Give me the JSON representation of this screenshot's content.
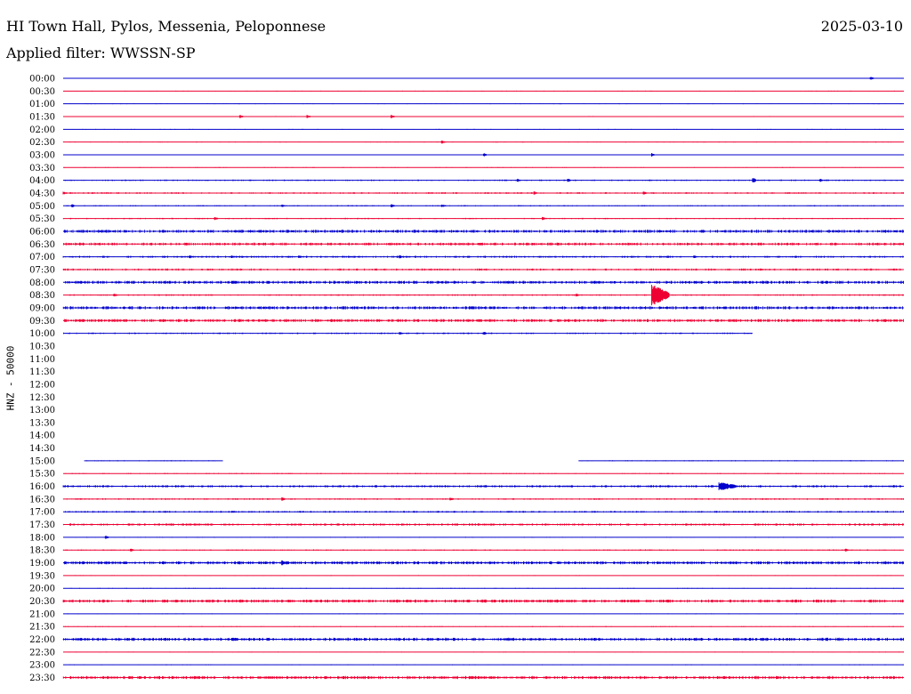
{
  "header": {
    "station": "HI Town Hall, Pylos, Messenia, Peloponnese",
    "date": "2025-03-10",
    "filter": "Applied filter: WWSSN-SP"
  },
  "chart_data": {
    "type": "line",
    "ylabel": "HNZ - 50000",
    "colors": {
      "even_row": "#0000cc",
      "odd_row": "#ee0033"
    },
    "rows": [
      {
        "time": "00:00",
        "coverage": [
          [
            0,
            1
          ]
        ],
        "activity": 0.05,
        "events": [
          {
            "pos": 0.96,
            "amp": 2
          }
        ]
      },
      {
        "time": "00:30",
        "coverage": [
          [
            0,
            1
          ]
        ],
        "activity": 0.05,
        "events": []
      },
      {
        "time": "01:00",
        "coverage": [
          [
            0,
            1
          ]
        ],
        "activity": 0.05,
        "events": []
      },
      {
        "time": "01:30",
        "coverage": [
          [
            0,
            1
          ]
        ],
        "activity": 0.12,
        "events": [
          {
            "pos": 0.21,
            "amp": 2
          },
          {
            "pos": 0.29,
            "amp": 2
          },
          {
            "pos": 0.39,
            "amp": 2
          }
        ]
      },
      {
        "time": "02:00",
        "coverage": [
          [
            0,
            1
          ]
        ],
        "activity": 0.05,
        "events": []
      },
      {
        "time": "02:30",
        "coverage": [
          [
            0,
            1
          ]
        ],
        "activity": 0.08,
        "events": [
          {
            "pos": 0.45,
            "amp": 2
          }
        ]
      },
      {
        "time": "03:00",
        "coverage": [
          [
            0,
            1
          ]
        ],
        "activity": 0.08,
        "events": [
          {
            "pos": 0.5,
            "amp": 2
          },
          {
            "pos": 0.7,
            "amp": 2
          }
        ]
      },
      {
        "time": "03:30",
        "coverage": [
          [
            0,
            1
          ]
        ],
        "activity": 0.05,
        "events": []
      },
      {
        "time": "04:00",
        "coverage": [
          [
            0,
            1
          ]
        ],
        "activity": 0.35,
        "events": [
          {
            "pos": 0.54,
            "amp": 2
          },
          {
            "pos": 0.6,
            "amp": 2
          },
          {
            "pos": 0.82,
            "amp": 4
          },
          {
            "pos": 0.9,
            "amp": 2
          }
        ]
      },
      {
        "time": "04:30",
        "coverage": [
          [
            0,
            1
          ]
        ],
        "activity": 0.45,
        "events": [
          {
            "pos": 0.0,
            "amp": 2
          },
          {
            "pos": 0.56,
            "amp": 2
          },
          {
            "pos": 0.69,
            "amp": 2
          }
        ]
      },
      {
        "time": "05:00",
        "coverage": [
          [
            0,
            1
          ]
        ],
        "activity": 0.25,
        "events": [
          {
            "pos": 0.01,
            "amp": 2
          },
          {
            "pos": 0.26,
            "amp": 2
          },
          {
            "pos": 0.39,
            "amp": 2
          },
          {
            "pos": 0.45,
            "amp": 2
          }
        ]
      },
      {
        "time": "05:30",
        "coverage": [
          [
            0,
            1
          ]
        ],
        "activity": 0.3,
        "events": [
          {
            "pos": 0.18,
            "amp": 2
          },
          {
            "pos": 0.57,
            "amp": 2
          }
        ]
      },
      {
        "time": "06:00",
        "coverage": [
          [
            0,
            1
          ]
        ],
        "activity": 1.0,
        "events": []
      },
      {
        "time": "06:30",
        "coverage": [
          [
            0,
            1
          ]
        ],
        "activity": 0.9,
        "events": []
      },
      {
        "time": "07:00",
        "coverage": [
          [
            0,
            1
          ]
        ],
        "activity": 0.6,
        "events": [
          {
            "pos": 0.15,
            "amp": 2
          },
          {
            "pos": 0.2,
            "amp": 2
          },
          {
            "pos": 0.28,
            "amp": 2
          },
          {
            "pos": 0.4,
            "amp": 2
          },
          {
            "pos": 0.75,
            "amp": 2
          }
        ]
      },
      {
        "time": "07:30",
        "coverage": [
          [
            0,
            1
          ]
        ],
        "activity": 0.6,
        "events": []
      },
      {
        "time": "08:00",
        "coverage": [
          [
            0,
            1
          ]
        ],
        "activity": 1.0,
        "events": []
      },
      {
        "time": "08:30",
        "coverage": [
          [
            0,
            1
          ]
        ],
        "activity": 0.4,
        "events": [
          {
            "pos": 0.06,
            "amp": 2
          },
          {
            "pos": 0.61,
            "amp": 2
          },
          {
            "pos": 0.7,
            "amp": 12
          }
        ]
      },
      {
        "time": "09:00",
        "coverage": [
          [
            0,
            1
          ]
        ],
        "activity": 1.0,
        "events": []
      },
      {
        "time": "09:30",
        "coverage": [
          [
            0,
            1
          ]
        ],
        "activity": 1.0,
        "events": []
      },
      {
        "time": "10:00",
        "coverage": [
          [
            0,
            0.82
          ]
        ],
        "activity": 0.4,
        "events": [
          {
            "pos": 0.4,
            "amp": 2
          },
          {
            "pos": 0.5,
            "amp": 2
          }
        ]
      },
      {
        "time": "10:30",
        "coverage": [],
        "activity": 0,
        "events": []
      },
      {
        "time": "11:00",
        "coverage": [],
        "activity": 0,
        "events": []
      },
      {
        "time": "11:30",
        "coverage": [],
        "activity": 0,
        "events": []
      },
      {
        "time": "12:00",
        "coverage": [],
        "activity": 0,
        "events": []
      },
      {
        "time": "12:30",
        "coverage": [],
        "activity": 0,
        "events": []
      },
      {
        "time": "13:00",
        "coverage": [],
        "activity": 0,
        "events": []
      },
      {
        "time": "13:30",
        "coverage": [],
        "activity": 0,
        "events": []
      },
      {
        "time": "14:00",
        "coverage": [],
        "activity": 0,
        "events": []
      },
      {
        "time": "14:30",
        "coverage": [],
        "activity": 0,
        "events": []
      },
      {
        "time": "15:00",
        "coverage": [
          [
            0.025,
            0.19
          ],
          [
            0.613,
            1
          ]
        ],
        "activity": 0.2,
        "events": []
      },
      {
        "time": "15:30",
        "coverage": [
          [
            0,
            1
          ]
        ],
        "activity": 0.2,
        "events": []
      },
      {
        "time": "16:00",
        "coverage": [
          [
            0,
            1
          ]
        ],
        "activity": 0.7,
        "events": [
          {
            "pos": 0.78,
            "amp": 5
          }
        ]
      },
      {
        "time": "16:30",
        "coverage": [
          [
            0,
            1
          ]
        ],
        "activity": 0.4,
        "events": [
          {
            "pos": 0.26,
            "amp": 2
          },
          {
            "pos": 0.46,
            "amp": 2
          }
        ]
      },
      {
        "time": "17:00",
        "coverage": [
          [
            0,
            1
          ]
        ],
        "activity": 0.5,
        "events": []
      },
      {
        "time": "17:30",
        "coverage": [
          [
            0,
            1
          ]
        ],
        "activity": 0.7,
        "events": []
      },
      {
        "time": "18:00",
        "coverage": [
          [
            0,
            1
          ]
        ],
        "activity": 0.08,
        "events": [
          {
            "pos": 0.05,
            "amp": 2
          }
        ]
      },
      {
        "time": "18:30",
        "coverage": [
          [
            0,
            1
          ]
        ],
        "activity": 0.3,
        "events": [
          {
            "pos": 0.08,
            "amp": 2
          },
          {
            "pos": 0.93,
            "amp": 2
          }
        ]
      },
      {
        "time": "19:00",
        "coverage": [
          [
            0,
            1
          ]
        ],
        "activity": 1.0,
        "events": [
          {
            "pos": 0.26,
            "amp": 3
          }
        ]
      },
      {
        "time": "19:30",
        "coverage": [
          [
            0,
            1
          ]
        ],
        "activity": 0.05,
        "events": []
      },
      {
        "time": "20:00",
        "coverage": [
          [
            0,
            1
          ]
        ],
        "activity": 0.1,
        "events": []
      },
      {
        "time": "20:30",
        "coverage": [
          [
            0,
            1
          ]
        ],
        "activity": 1.0,
        "events": []
      },
      {
        "time": "21:00",
        "coverage": [
          [
            0,
            1
          ]
        ],
        "activity": 0.05,
        "events": []
      },
      {
        "time": "21:30",
        "coverage": [
          [
            0,
            1
          ]
        ],
        "activity": 0.1,
        "events": []
      },
      {
        "time": "22:00",
        "coverage": [
          [
            0,
            1
          ]
        ],
        "activity": 1.0,
        "events": []
      },
      {
        "time": "22:30",
        "coverage": [
          [
            0,
            1
          ]
        ],
        "activity": 0.05,
        "events": []
      },
      {
        "time": "23:00",
        "coverage": [
          [
            0,
            1
          ]
        ],
        "activity": 0.05,
        "events": []
      },
      {
        "time": "23:30",
        "coverage": [
          [
            0,
            1
          ]
        ],
        "activity": 1.0,
        "events": []
      }
    ]
  }
}
